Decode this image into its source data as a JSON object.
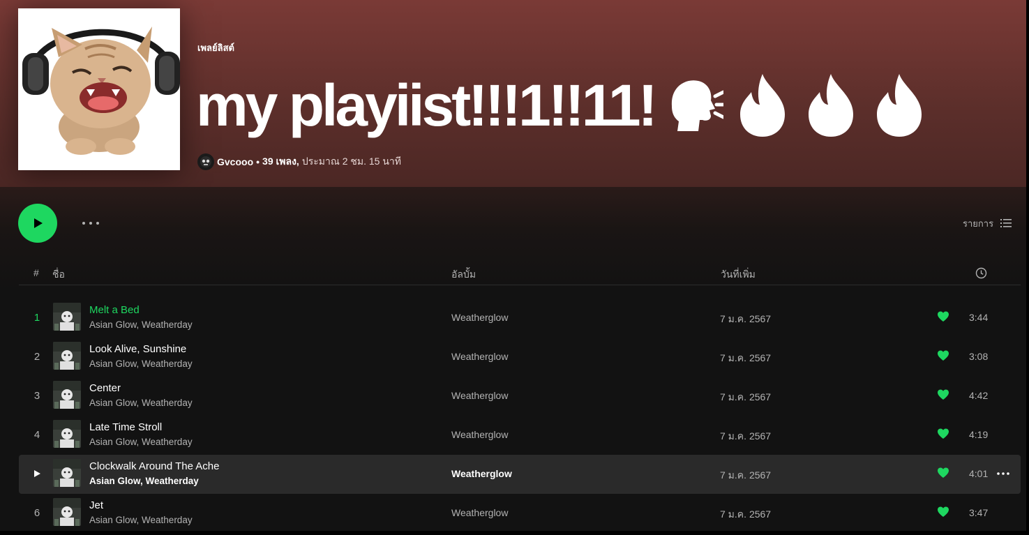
{
  "playlist": {
    "type_label": "เพลย์ลิสต์",
    "title": "my playiist!!!1!!11!",
    "title_emojis": [
      "speaking-head-icon",
      "fire-icon",
      "fire-icon",
      "fire-icon"
    ],
    "owner": "Gvcooo",
    "separator": "•",
    "song_count": "39 เพลง,",
    "duration": "ประมาณ 2 ชม. 15 นาที"
  },
  "actions": {
    "list_view_label": "รายการ"
  },
  "columns": {
    "index": "#",
    "title": "ชื่อ",
    "album": "อัลบั้ม",
    "date_added": "วันที่เพิ่ม"
  },
  "tracks": [
    {
      "index": "1",
      "title": "Melt a Bed",
      "artist": "Asian Glow, Weatherday",
      "album": "Weatherglow",
      "date_added": "7 ม.ค. 2567",
      "duration": "3:44",
      "state": "playing"
    },
    {
      "index": "2",
      "title": "Look Alive, Sunshine",
      "artist": "Asian Glow, Weatherday",
      "album": "Weatherglow",
      "date_added": "7 ม.ค. 2567",
      "duration": "3:08",
      "state": "normal"
    },
    {
      "index": "3",
      "title": "Center",
      "artist": "Asian Glow, Weatherday",
      "album": "Weatherglow",
      "date_added": "7 ม.ค. 2567",
      "duration": "4:42",
      "state": "normal"
    },
    {
      "index": "4",
      "title": "Late Time Stroll",
      "artist": "Asian Glow, Weatherday",
      "album": "Weatherglow",
      "date_added": "7 ม.ค. 2567",
      "duration": "4:19",
      "state": "normal"
    },
    {
      "index": "5",
      "title": "Clockwalk Around The Ache",
      "artist": "Asian Glow, Weatherday",
      "album": "Weatherglow",
      "date_added": "7 ม.ค. 2567",
      "duration": "4:01",
      "state": "hover"
    },
    {
      "index": "6",
      "title": "Jet",
      "artist": "Asian Glow, Weatherday",
      "album": "Weatherglow",
      "date_added": "7 ม.ค. 2567",
      "duration": "3:47",
      "state": "normal"
    }
  ],
  "colors": {
    "accent": "#1ed760",
    "header_gradient_top": "#7a3a36",
    "background": "#121212",
    "row_hover": "#2a2a2a"
  }
}
